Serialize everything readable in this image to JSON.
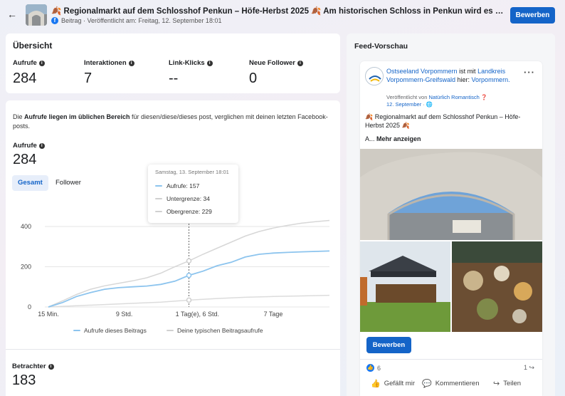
{
  "header": {
    "title": "🍂 Regionalmarkt auf dem Schlosshof Penkun – Höfe-Herbst 2025 🍂 Am historischen Schloss in Penkun wird es bunt, lebendig und ...",
    "subtitle": "Beitrag · Veröffentlicht am: Freitag, 12. September 18:01",
    "boost_label": "Bewerben"
  },
  "overview": {
    "title": "Übersicht",
    "metrics": [
      {
        "label": "Aufrufe",
        "value": "284"
      },
      {
        "label": "Interaktionen",
        "value": "7"
      },
      {
        "label": "Link-Klicks",
        "value": "--"
      },
      {
        "label": "Neue Follower",
        "value": "0"
      }
    ]
  },
  "details": {
    "desc_pre": "Die ",
    "desc_bold": "Aufrufe liegen im üblichen Bereich",
    "desc_post": " für diesen/diese/dieses post, verglichen mit deinen letzten Facebook-posts.",
    "views_label": "Aufrufe",
    "views_value": "284",
    "tab_all": "Gesamt",
    "tab_follower": "Follower",
    "viewers_label": "Betrachter",
    "viewers_value": "183"
  },
  "tooltip": {
    "title": "Samstag, 13. September 18:01",
    "rows": [
      "Aufrufe: 157",
      "Untergrenze: 34",
      "Obergrenze: 229"
    ]
  },
  "chart_data": {
    "type": "line",
    "x_ticks": [
      "15 Min.",
      "9 Std.",
      "1 Tag(e), 6 Std.",
      "7 Tage"
    ],
    "y_ticks": [
      0,
      200,
      400
    ],
    "ylim": [
      0,
      460
    ],
    "xlim": [
      0,
      100
    ],
    "series": [
      {
        "name": "Aufrufe dieses Beitrags",
        "color": "#8cc4ee",
        "x": [
          0,
          5,
          10,
          15,
          20,
          25,
          30,
          35,
          40,
          45,
          50,
          55,
          60,
          65,
          70,
          75,
          80,
          85,
          90,
          95,
          100
        ],
        "y": [
          0,
          22,
          52,
          72,
          88,
          96,
          100,
          104,
          112,
          128,
          157,
          178,
          205,
          222,
          248,
          262,
          268,
          271,
          274,
          276,
          278
        ]
      },
      {
        "name": "Obergrenze",
        "color": "#d7d7d7",
        "x": [
          0,
          5,
          10,
          15,
          20,
          25,
          30,
          35,
          40,
          45,
          50,
          55,
          60,
          65,
          70,
          75,
          80,
          85,
          90,
          95,
          100
        ],
        "y": [
          0,
          30,
          62,
          88,
          105,
          118,
          130,
          145,
          168,
          200,
          229,
          262,
          292,
          322,
          352,
          375,
          392,
          405,
          416,
          424,
          430
        ]
      },
      {
        "name": "Untergrenze",
        "color": "#dcdcdc",
        "x": [
          0,
          10,
          20,
          30,
          40,
          50,
          60,
          70,
          80,
          90,
          100
        ],
        "y": [
          0,
          6,
          12,
          18,
          24,
          34,
          42,
          48,
          52,
          55,
          58
        ]
      }
    ],
    "highlight_x": 50,
    "legend": [
      "Aufrufe dieses Beitrags",
      "Deine typischen Beitragsaufrufe"
    ],
    "legend_colors": [
      "#8cc4ee",
      "#d0d0d0"
    ]
  },
  "feed": {
    "title": "Feed-Vorschau",
    "page_name": "Ostseeland Vorpommern",
    "with_text": " ist mit ",
    "partner": "Landkreis Vorpommern-Greifswald",
    "here_text": " hier: ",
    "place": "Vorpommern.",
    "meta_pre": "Veröffentlicht von ",
    "meta_author": "Natürlich Romantisch",
    "meta_date": "12. September",
    "text": "🍂 Regionalmarkt auf dem Schlosshof Penkun – Höfe-Herbst 2025 🍂",
    "more_pre": "A... ",
    "more_link": "Mehr anzeigen",
    "boost_label": "Bewerben",
    "likes": "6",
    "shares": "1",
    "actions": [
      "Gefällt mir",
      "Kommentieren",
      "Teilen"
    ]
  }
}
